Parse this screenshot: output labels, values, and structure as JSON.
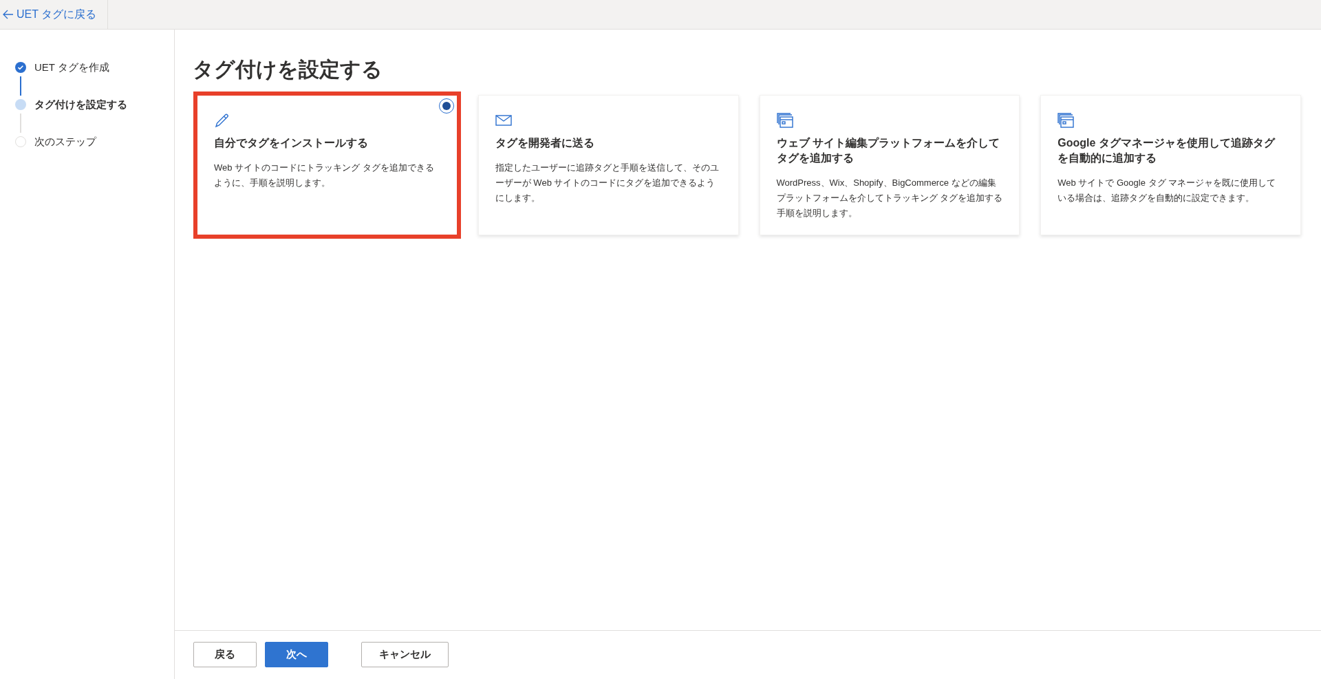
{
  "top_bar": {
    "back_link": "UET タグに戻る"
  },
  "steps": [
    {
      "label": "UET タグを作成",
      "kind": "done"
    },
    {
      "label": "タグ付けを設定する",
      "kind": "current"
    },
    {
      "label": "次のステップ",
      "kind": "pending"
    }
  ],
  "heading": "タグ付けを設定する",
  "cards": [
    {
      "kind": "pencil",
      "title": "自分でタグをインストールする",
      "description": "Web サイトのコードにトラッキング タグを追加できるように、手順を説明します。",
      "selected": true,
      "highlighted": true
    },
    {
      "kind": "envelope",
      "title": "タグを開発者に送る",
      "description": "指定したユーザーに追跡タグと手順を送信して、そのユーザーが Web サイトのコードにタグを追加できるようにします。",
      "selected": false,
      "highlighted": false
    },
    {
      "kind": "window",
      "title": "ウェブ サイト編集プラットフォームを介してタグを追加する",
      "description": "WordPress、Wix、Shopify、BigCommerce などの編集プラットフォームを介してトラッキング タグを追加する手順を説明します。",
      "selected": false,
      "highlighted": false
    },
    {
      "kind": "window",
      "title": "Google タグマネージャを使用して追跡タグを自動的に追加する",
      "description": "Web サイトで Google タグ マネージャを既に使用している場合は、追跡タグを自動的に設定できます。",
      "selected": false,
      "highlighted": false
    }
  ],
  "footer_buttons": [
    {
      "label": "戻る",
      "kind": "secondary"
    },
    {
      "label": "次へ",
      "kind": "primary"
    },
    {
      "label": "キャンセル",
      "kind": "secondary"
    }
  ]
}
